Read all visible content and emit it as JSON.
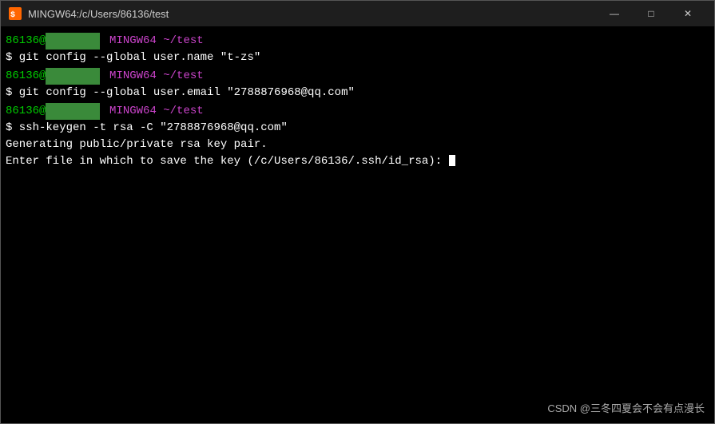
{
  "titleBar": {
    "title": "MINGW64:/c/Users/86136/test",
    "icon": "terminal-icon",
    "minimize": "—",
    "maximize": "□",
    "close": "✕"
  },
  "terminal": {
    "lines": [
      {
        "type": "prompt",
        "user": "86136",
        "host_masked": true,
        "prefix": "MINGW64",
        "path": "~/test"
      },
      {
        "type": "command",
        "text": "$ git config --global user.name \"t-zs\""
      },
      {
        "type": "prompt",
        "user": "86136",
        "host_masked": true,
        "prefix": "MINGW64",
        "path": "~/test"
      },
      {
        "type": "command",
        "text": "$ git config --global user.email \"2788876968@qq.com\""
      },
      {
        "type": "prompt",
        "user": "86136",
        "host_masked": true,
        "prefix": "MINGW64",
        "path": "~/test"
      },
      {
        "type": "command",
        "text": "$ ssh-keygen -t rsa -C \"2788876968@qq.com\""
      },
      {
        "type": "output",
        "text": "Generating public/private rsa key pair."
      },
      {
        "type": "output",
        "text": "Enter file in which to save the key (/c/Users/86136/.ssh/id_rsa): "
      }
    ]
  },
  "watermark": {
    "text": "CSDN @三冬四夏会不会有点漫长"
  }
}
